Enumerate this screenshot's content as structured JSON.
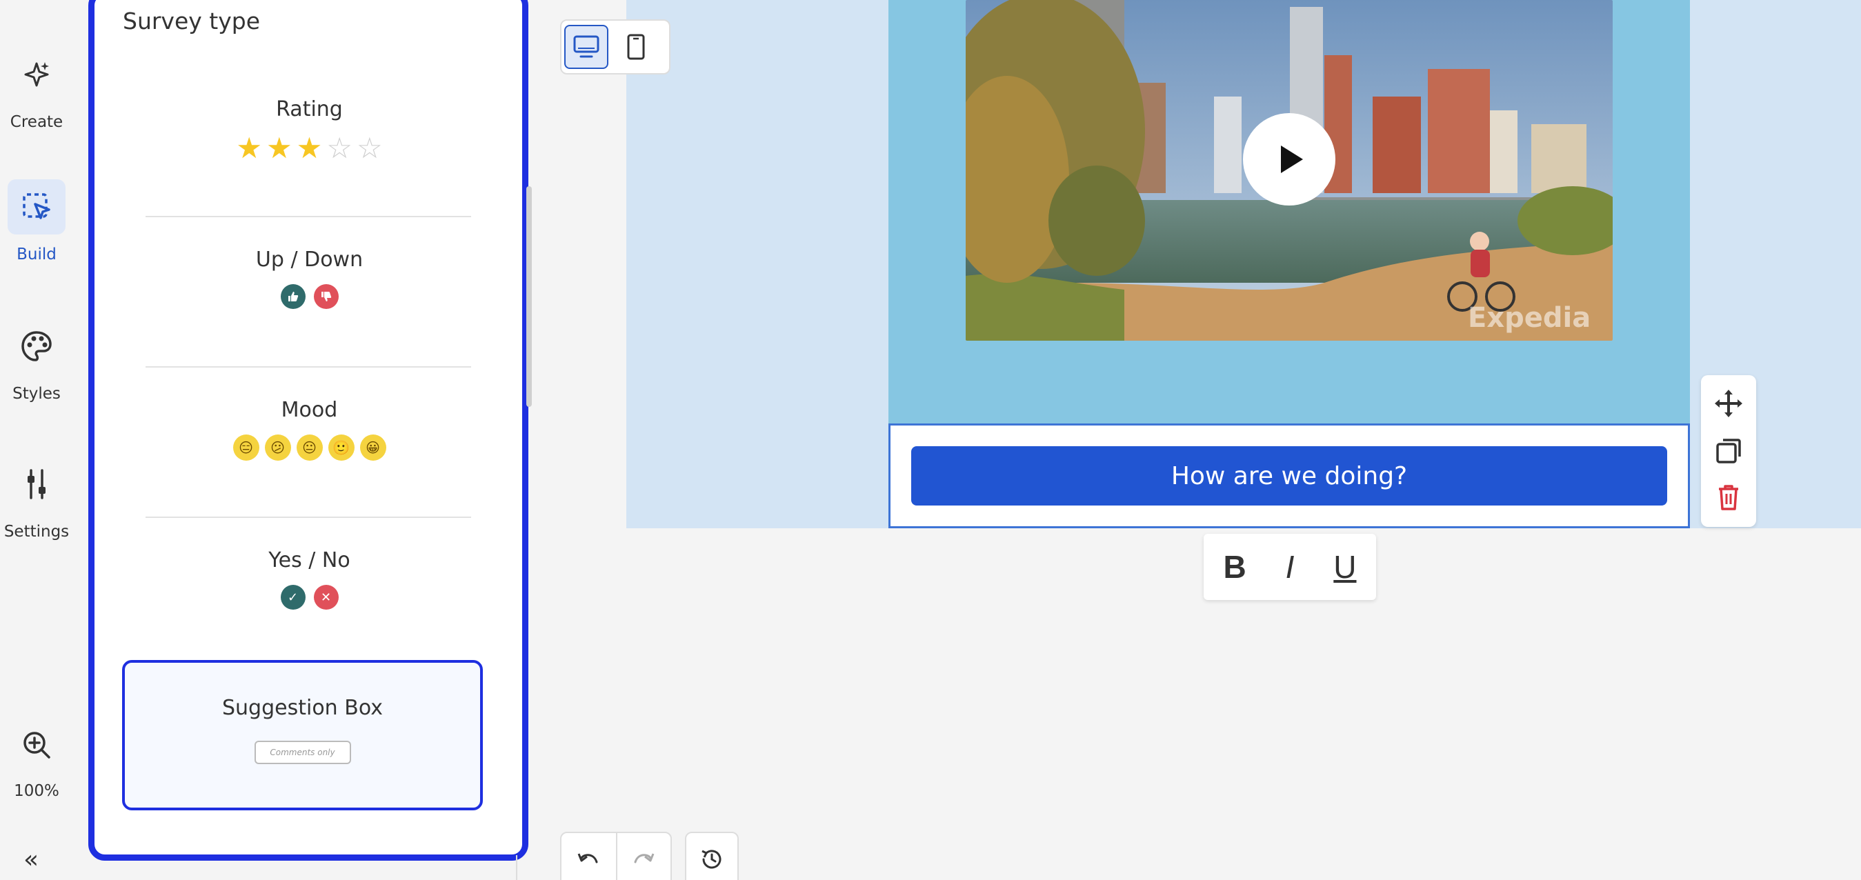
{
  "rail": {
    "items": [
      {
        "label": "Create",
        "icon": "sparkle-icon"
      },
      {
        "label": "Build",
        "icon": "cursor-select-icon",
        "active": true
      },
      {
        "label": "Styles",
        "icon": "palette-icon"
      },
      {
        "label": "Settings",
        "icon": "sliders-icon"
      }
    ],
    "zoom_label": "100%",
    "collapse_label": "«"
  },
  "panel": {
    "title": "Survey type",
    "items": [
      {
        "name": "Rating"
      },
      {
        "name": "Up / Down"
      },
      {
        "name": "Mood"
      },
      {
        "name": "Yes / No"
      },
      {
        "name": "Suggestion Box",
        "placeholder": "Comments only",
        "selected": true
      }
    ],
    "rating_value": 3,
    "rating_max": 5
  },
  "canvas": {
    "cta_text": "How are we doing?",
    "watermark": "Expedia"
  },
  "format": {
    "bold": "B",
    "italic": "I",
    "underline": "U"
  },
  "colors": {
    "accent": "#2155d2",
    "panel_border": "#1e2fe0",
    "canvas_block": "#86c6e2",
    "thumb_up": "#2f6b6b",
    "thumb_down": "#e0505a",
    "delete": "#d9343f"
  }
}
